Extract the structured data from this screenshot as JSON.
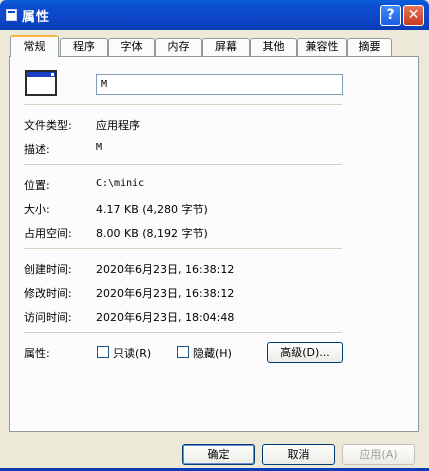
{
  "window": {
    "title": "属性"
  },
  "titlebar": {
    "help_label": "?",
    "close_label": "✕"
  },
  "tabs": [
    {
      "label": "常规",
      "active": true
    },
    {
      "label": "程序"
    },
    {
      "label": "字体"
    },
    {
      "label": "内存"
    },
    {
      "label": "屏幕"
    },
    {
      "label": "其他"
    },
    {
      "label": "兼容性"
    },
    {
      "label": "摘要"
    }
  ],
  "general": {
    "name_value": "M",
    "file_type_label": "文件类型:",
    "file_type_value": "应用程序",
    "description_label": "描述:",
    "description_value": "M",
    "location_label": "位置:",
    "location_value": "C:\\minic",
    "size_label": "大小:",
    "size_value": "4.17 KB (4,280 字节)",
    "disk_size_label": "占用空间:",
    "disk_size_value": "8.00 KB (8,192 字节)",
    "created_label": "创建时间:",
    "created_value": "2020年6月23日, 16:38:12",
    "modified_label": "修改时间:",
    "modified_value": "2020年6月23日, 16:38:12",
    "accessed_label": "访问时间:",
    "accessed_value": "2020年6月23日, 18:04:48",
    "attributes_label": "属性:",
    "readonly_label": "只读(R)",
    "hidden_label": "隐藏(H)",
    "advanced_label": "高级(D)..."
  },
  "footer": {
    "ok_label": "确定",
    "cancel_label": "取消",
    "apply_label": "应用(A)"
  },
  "colors": {
    "title_bar": "#0a4fd0",
    "dialog_bg": "#ece9d8",
    "close_button": "#c9391c"
  },
  "icons": {
    "app": "window-icon",
    "program": "program-window-icon"
  }
}
